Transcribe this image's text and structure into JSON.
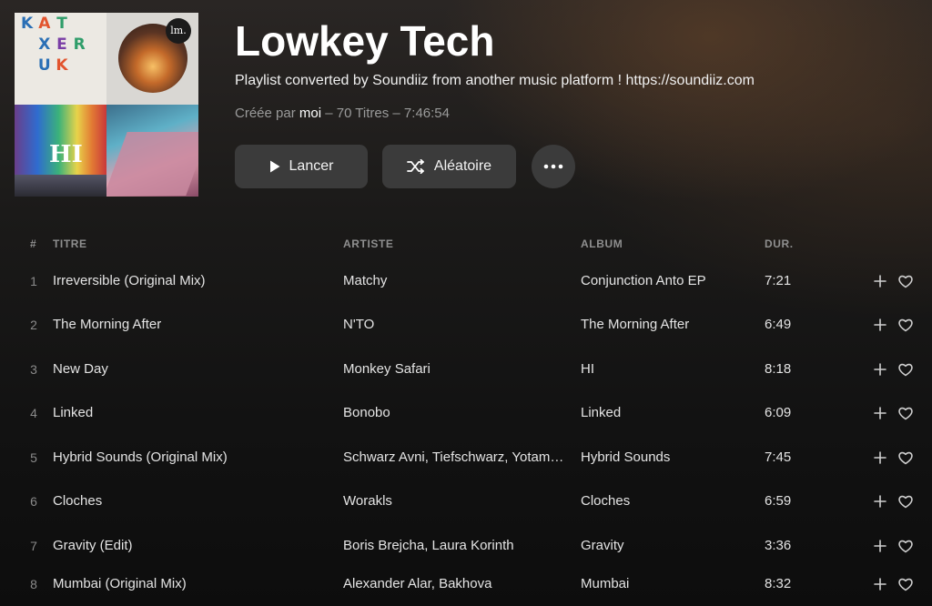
{
  "playlist": {
    "title": "Lowkey Tech",
    "description": "Playlist converted by Soundiiz from another music platform ! https://soundiiz.com",
    "created_prefix": "Créée par",
    "owner": "moi",
    "stats": "– 70 Titres – 7:46:54"
  },
  "cover": {
    "logo_text": "lm.",
    "hi_text": "HI",
    "letters": [
      "K",
      "A",
      "T",
      "",
      "",
      "",
      "X",
      "E",
      "R",
      "",
      "",
      "U",
      "K",
      "",
      "",
      "",
      "",
      "",
      "",
      ""
    ]
  },
  "actions": {
    "play_label": "Lancer",
    "shuffle_label": "Aléatoire",
    "more_icon": "more-icon"
  },
  "table": {
    "headers": {
      "num": "#",
      "title": "TITRE",
      "artist": "ARTISTE",
      "album": "ALBUM",
      "duration": "DUR."
    },
    "rows": [
      {
        "num": "1",
        "title": "Irreversible (Original Mix)",
        "artist": "Matchy",
        "album": "Conjunction Anto EP",
        "duration": "7:21"
      },
      {
        "num": "2",
        "title": "The Morning After",
        "artist": "N'TO",
        "album": "The Morning After",
        "duration": "6:49"
      },
      {
        "num": "3",
        "title": "New Day",
        "artist": "Monkey Safari",
        "album": "HI",
        "duration": "8:18"
      },
      {
        "num": "4",
        "title": "Linked",
        "artist": "Bonobo",
        "album": "Linked",
        "duration": "6:09"
      },
      {
        "num": "5",
        "title": "Hybrid Sounds (Original Mix)",
        "artist": "Schwarz Avni, Tiefschwarz, Yotam A...",
        "album": "Hybrid Sounds",
        "duration": "7:45"
      },
      {
        "num": "6",
        "title": "Cloches",
        "artist": "Worakls",
        "album": "Cloches",
        "duration": "6:59"
      },
      {
        "num": "7",
        "title": "Gravity (Edit)",
        "artist": "Boris Brejcha, Laura Korinth",
        "album": "Gravity",
        "duration": "3:36"
      },
      {
        "num": "8",
        "title": "Mumbai (Original Mix)",
        "artist": "Alexander Alar, Bakhova",
        "album": "Mumbai",
        "duration": "8:32"
      }
    ]
  },
  "icons": {
    "play": "play-icon",
    "shuffle": "shuffle-icon",
    "add": "plus-icon",
    "like": "heart-icon"
  }
}
